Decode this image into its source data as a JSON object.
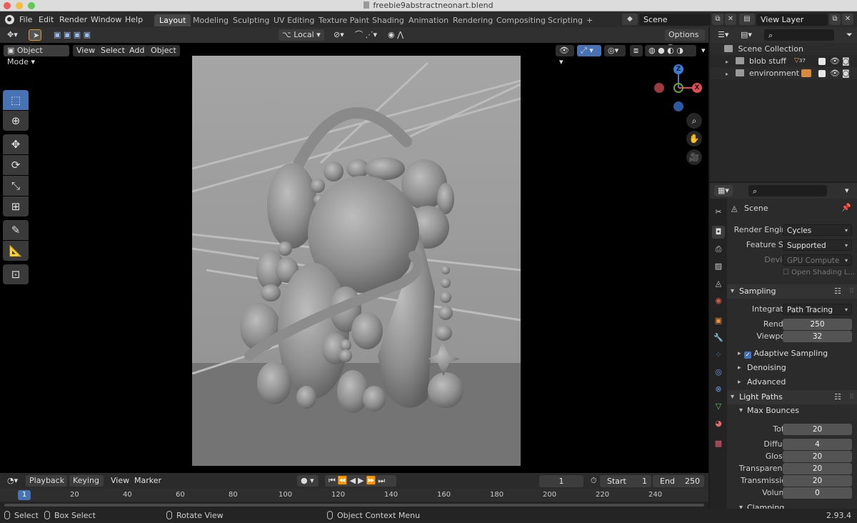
{
  "window": {
    "title": "freebie9abstractneonart.blend"
  },
  "menu": [
    "File",
    "Edit",
    "Render",
    "Window",
    "Help"
  ],
  "workspaces": [
    "Layout",
    "Modeling",
    "Sculpting",
    "UV Editing",
    "Texture Paint",
    "Shading",
    "Animation",
    "Rendering",
    "Compositing",
    "Scripting"
  ],
  "active_workspace": "Layout",
  "add_workspace": "+",
  "scene_field": "Scene",
  "view_layer_field": "View Layer",
  "tool_header": {
    "orientation": "Local",
    "options": "Options"
  },
  "viewport_header": {
    "mode": "Object Mode",
    "menus": [
      "View",
      "Select",
      "Add",
      "Object"
    ]
  },
  "gizmo": {
    "z": "Z",
    "x": "X"
  },
  "timeline": {
    "editor_menus": [
      "Playback",
      "Keying",
      "View",
      "Marker"
    ],
    "current_frame": "1",
    "start_label": "Start",
    "start": "1",
    "end_label": "End",
    "end": "250",
    "ticks": [
      "1",
      "20",
      "40",
      "60",
      "80",
      "100",
      "120",
      "140",
      "160",
      "180",
      "200",
      "220",
      "240"
    ]
  },
  "statusbar": {
    "select": "Select",
    "box_select": "Box Select",
    "rotate_view": "Rotate View",
    "context_menu": "Object Context Menu",
    "version": "2.93.4"
  },
  "outliner": {
    "root": "Scene Collection",
    "items": [
      {
        "label": "blob stuff",
        "badge": "37"
      },
      {
        "label": "environment"
      }
    ]
  },
  "properties": {
    "context": "Scene",
    "render_engine_label": "Render Engine",
    "render_engine": "Cycles",
    "feature_set_label": "Feature Set",
    "feature_set": "Supported",
    "device_label": "Device",
    "device": "GPU Compute",
    "open_shading": "Open Shading L...",
    "sampling": {
      "title": "Sampling",
      "integrator_label": "Integrator",
      "integrator": "Path Tracing",
      "render_label": "Render",
      "render": "250",
      "viewport_label": "Viewport",
      "viewport": "32",
      "adaptive": "Adaptive Sampling",
      "denoising": "Denoising",
      "advanced": "Advanced"
    },
    "light_paths": {
      "title": "Light Paths",
      "max_bounces": "Max Bounces",
      "rows": [
        {
          "label": "Total",
          "value": "20"
        },
        {
          "label": "Diffuse",
          "value": "4"
        },
        {
          "label": "Glossy",
          "value": "20"
        },
        {
          "label": "Transparency",
          "value": "20"
        },
        {
          "label": "Transmission",
          "value": "20"
        },
        {
          "label": "Volume",
          "value": "0"
        }
      ],
      "clamping": "Clamping"
    }
  },
  "colors": {
    "accent": "#4772b3",
    "x_axis": "#e04b55",
    "y_axis": "#6ba232",
    "z_axis": "#3a7cd6"
  }
}
